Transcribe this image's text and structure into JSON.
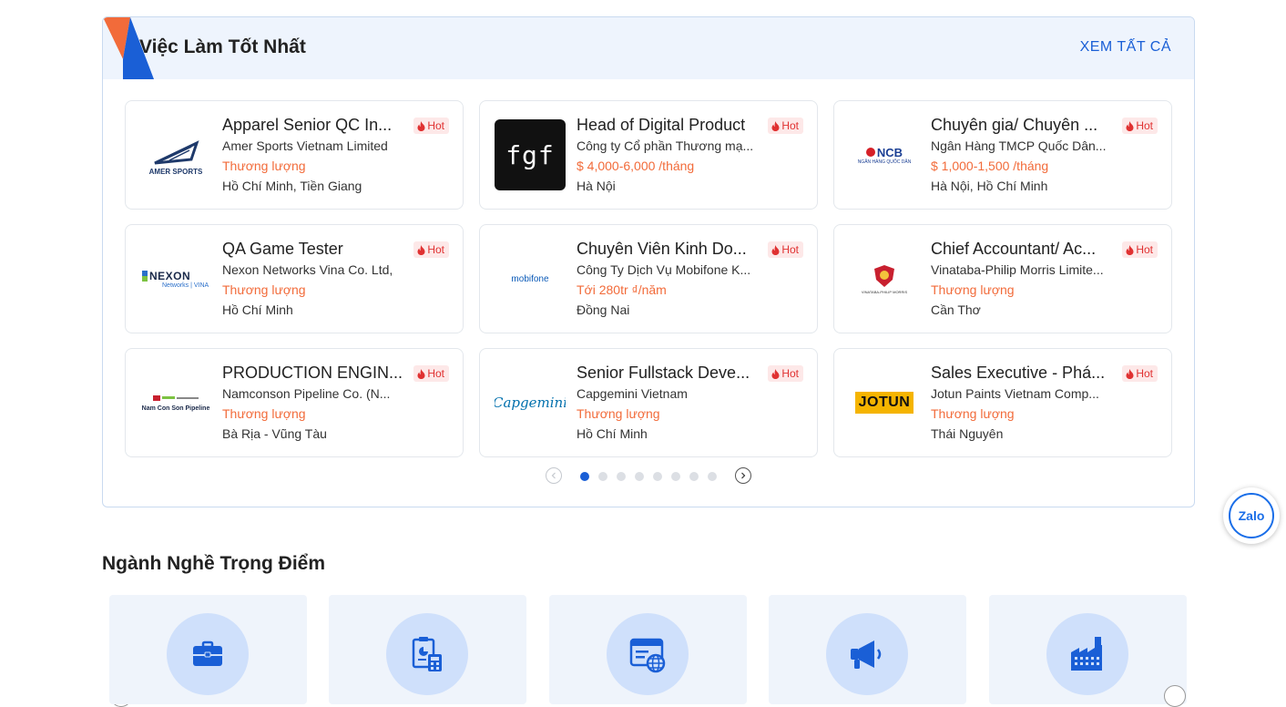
{
  "best_jobs": {
    "title": "Việc Làm Tốt Nhất",
    "see_all": "XEM TẤT CẢ",
    "hot_label": "Hot",
    "jobs": [
      {
        "title": "Apparel Senior QC In...",
        "company": "Amer Sports Vietnam Limited",
        "salary": "Thương lượng",
        "location": "Hồ Chí Minh, Tiền Giang",
        "logo": "amer-sports-logo",
        "logo_text": "AMER SPORTS"
      },
      {
        "title": "Head of Digital Product",
        "company": "Công ty Cổ phần Thương mạ...",
        "salary": "$ 4,000-6,000 /tháng",
        "location": "Hà Nội",
        "logo": "fgf-logo",
        "logo_text": "fgf"
      },
      {
        "title": "Chuyên gia/ Chuyên ...",
        "company": "Ngân Hàng TMCP Quốc Dân...",
        "salary": "$ 1,000-1,500 /tháng",
        "location": "Hà Nội, Hồ Chí Minh",
        "logo": "ncb-logo",
        "logo_text": "NCB",
        "logo_sub": "NGÂN HÀNG QUỐC DÂN"
      },
      {
        "title": "QA Game Tester",
        "company": "Nexon Networks Vina Co. Ltd,",
        "salary": "Thương lượng",
        "location": "Hồ Chí Minh",
        "logo": "nexon-logo",
        "logo_text": "NEXON",
        "logo_sub": "Networks | VINA"
      },
      {
        "title": "Chuyên Viên Kinh Do...",
        "company": "Công Ty Dịch Vụ Mobifone K...",
        "salary": "Tới 280tr ₫/năm",
        "location": "Đồng Nai",
        "logo": "mobifone-logo",
        "logo_text": "mobifone"
      },
      {
        "title": "Chief Accountant/ Ac...",
        "company": "Vinataba-Philip Morris Limite...",
        "salary": "Thương lượng",
        "location": "Cần Thơ",
        "logo": "vinataba-logo",
        "logo_text": "VINATABA-PHILIP MORRIS"
      },
      {
        "title": "PRODUCTION ENGIN...",
        "company": "Namconson Pipeline Co. (N...",
        "salary": "Thương lượng",
        "location": "Bà Rịa - Vũng Tàu",
        "logo": "namconson-logo",
        "logo_text": "Nam Con Son Pipeline"
      },
      {
        "title": "Senior Fullstack Deve...",
        "company": "Capgemini Vietnam",
        "salary": "Thương lượng",
        "location": "Hồ Chí Minh",
        "logo": "capgemini-logo",
        "logo_text": "Capgemini"
      },
      {
        "title": "Sales Executive - Phá...",
        "company": "Jotun Paints Vietnam Comp...",
        "salary": "Thương lượng",
        "location": "Thái Nguyên",
        "logo": "jotun-logo",
        "logo_text": "JOTUN"
      }
    ],
    "pager": {
      "pages": 8,
      "active": 0
    }
  },
  "industries": {
    "title": "Ngành Nghề Trọng Điểm",
    "items": [
      {
        "icon": "briefcase-icon"
      },
      {
        "icon": "accounting-icon"
      },
      {
        "icon": "web-browser-icon"
      },
      {
        "icon": "megaphone-icon"
      },
      {
        "icon": "factory-icon"
      }
    ]
  },
  "zalo": {
    "label": "Zalo"
  },
  "colors": {
    "accent": "#1a5fd6",
    "salary": "#f26b3a",
    "hot_bg": "#fde8e8",
    "hot_text": "#e03131",
    "panel_head": "#eef4fd",
    "industry_card": "#eff4fb",
    "industry_circle": "#cfe0fb"
  }
}
